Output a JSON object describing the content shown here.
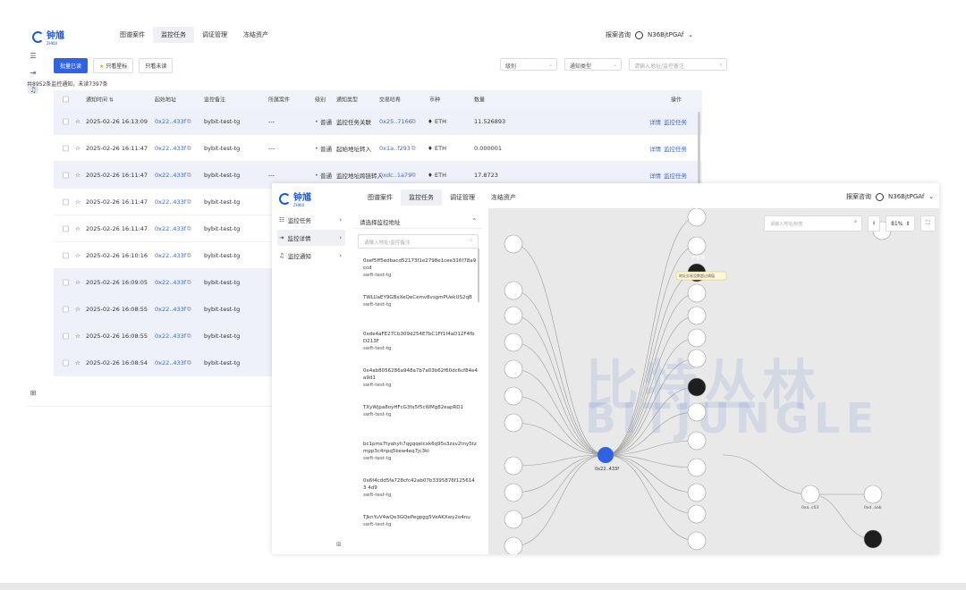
{
  "app": {
    "logo_text": "钟馗",
    "logo_sub": "ZHKUI"
  },
  "nav": {
    "items": [
      "图谱案件",
      "监控任务",
      "调证管理",
      "冻结资产"
    ],
    "active": 1
  },
  "header_right": {
    "report": "报案咨询",
    "user": "N36BjtPGAf"
  },
  "toolbar": {
    "batch_read": "批量已读",
    "starred_only": "只看星标",
    "unread_only": "只看未读"
  },
  "filters": {
    "level": "级别",
    "notify_type": "通知类型",
    "search_placeholder": "请输入地址/监控备注"
  },
  "summary": "共8952条监控通知，未读7397条",
  "table": {
    "headers": [
      "通知时间 ⇅",
      "起始地址",
      "监控备注",
      "所属案件",
      "级别",
      "通知类型",
      "交易哈希",
      "币种",
      "数量",
      "操作"
    ],
    "rows": [
      {
        "time": "2025-02-26 16:13:09",
        "addr": "0x22..433f",
        "note": "bybit-test-tg",
        "case": "---",
        "level": "普通",
        "type": "监控任务关联",
        "hash": "0x25..7166",
        "coin": "ETH",
        "amount": "11.526893",
        "hl": true
      },
      {
        "time": "2025-02-26 16:11:47",
        "addr": "0x22..433f",
        "note": "bybit-test-tg",
        "case": "---",
        "level": "普通",
        "type": "起始地址转入",
        "hash": "0x1a..f293",
        "coin": "ETH",
        "amount": "0.000001",
        "hl": false
      },
      {
        "time": "2025-02-26 16:11:47",
        "addr": "0x22..433f",
        "note": "bybit-test-tg",
        "case": "---",
        "level": "普通",
        "type": "监控地址跨链转入",
        "hash": "0xdc..1a79",
        "coin": "ETH",
        "amount": "17.8723",
        "hl": true
      },
      {
        "time": "2025-02-26 16:11:47",
        "addr": "0x22..433f",
        "note": "bybit-test-tg",
        "hl": false
      },
      {
        "time": "2025-02-26 16:11:47",
        "addr": "0x22..433f",
        "note": "bybit-test-tg",
        "hl": false
      },
      {
        "time": "2025-02-26 16:10:16",
        "addr": "0x22..433f",
        "note": "bybit-test-tg",
        "hl": false
      },
      {
        "time": "2025-02-26 16:09:05",
        "addr": "0x22..433f",
        "note": "bybit-test-tg",
        "hl": true
      },
      {
        "time": "2025-02-26 16:08:55",
        "addr": "0x22..433f",
        "note": "bybit-test-tg",
        "hl": true
      },
      {
        "time": "2025-02-26 16:08:55",
        "addr": "0x22..433f",
        "note": "bybit-test-tg",
        "hl": true
      },
      {
        "time": "2025-02-26 16:08:54",
        "addr": "0x22..433f",
        "note": "bybit-test-tg",
        "hl": true
      }
    ],
    "ops": [
      "详情",
      "监控任务"
    ]
  },
  "front": {
    "menu": [
      "监控任务",
      "监控详情",
      "监控通知"
    ],
    "panel_title": "请选择监控地址",
    "panel_search": "请输入地址/监控备注",
    "addresses": [
      {
        "a": "0xef5ff5edbacd52173f1e2798e1cee316f78a9ccd",
        "n": "swft-test-tg"
      },
      {
        "a": "TWLUaEY9GBxXeQeCemv8vsgmPUekUS2qB",
        "n": "swft-test-tg"
      },
      {
        "a": "0xde4aFE27Cb309d254E7bC1Ff1f4aD12F4fbD213F",
        "n": "swft-test-tg"
      },
      {
        "a": "0x4ab8056286a948a7b7a03b62f60dc6cf84e4a9d1",
        "n": "swft-test-tg"
      },
      {
        "a": "TXyWjpa8oyHFcG3fx5f5cWMg82eapRD1",
        "n": "swft-test-tg"
      },
      {
        "a": "bc1pms7tyahyh7qgqqelcxk6q95s3zxv2tny5tzmpp3c4npq5kew4eq7jc3kl",
        "n": "swft-test-tg"
      },
      {
        "a": "0x6f4cdd5fa728cfc42ab07b3395876f1256143 4d9",
        "n": "swft-test-tg"
      },
      {
        "a": "TJknYuV4wQe3GQePegpgg5VeAKXwy2o4nu",
        "n": "swft-test-tg"
      }
    ],
    "graph_search": "请输入地址/标签",
    "zoom": "81%",
    "watermark1": "比特丛林",
    "watermark2": "BITJUNGLE",
    "center_node": "0x22..433f",
    "tag_label": "已暂停",
    "tag_note": "地址交易没数超过阈值",
    "right_nodes": [
      "0xa..c03",
      "0xd..aab"
    ]
  }
}
